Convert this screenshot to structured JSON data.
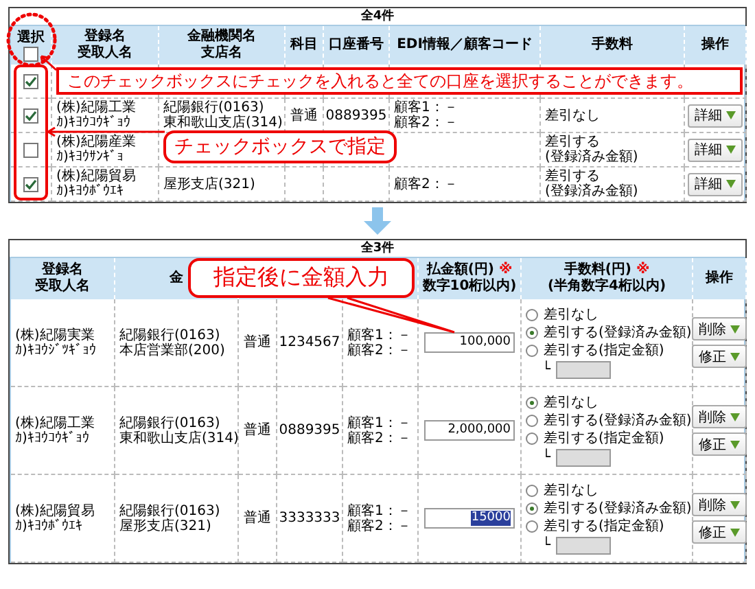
{
  "top": {
    "caption": "全4件",
    "headers": [
      [
        "選択"
      ],
      [
        "登録名",
        "受取人名"
      ],
      [
        "金融機関名",
        "支店名"
      ],
      [
        "科目"
      ],
      [
        "口座番号"
      ],
      [
        "EDI情報／顧客コード"
      ],
      [
        "手数料"
      ],
      [
        "操作"
      ]
    ],
    "select_all": {
      "checked": false
    },
    "rows": [
      {
        "checked": true
      },
      {
        "checked": true,
        "name": [
          "(株)紀陽工業",
          "ｶ)ｷﾖｳｺｳｷﾞｮｳ"
        ],
        "bank": [
          "紀陽銀行(0163)",
          "東和歌山支店(314)"
        ],
        "type": "普通",
        "account": "0889395",
        "edi": [
          "顧客1：－",
          "顧客2：－"
        ],
        "fee": [
          "差引なし"
        ],
        "action": "詳細"
      },
      {
        "checked": false,
        "name": [
          "(株)紀陽産業",
          "ｶ)ｷﾖｳｻﾝｷﾞｮ"
        ],
        "fee": [
          "差引する",
          "(登録済み金額)"
        ],
        "action": "詳細"
      },
      {
        "checked": true,
        "name": [
          "(株)紀陽貿易",
          "ｶ)ｷﾖｳﾎﾞｳｴｷ"
        ],
        "bank": [
          "屋形支店(321)"
        ],
        "edi": [
          "顧客2：－"
        ],
        "fee": [
          "差引する",
          "(登録済み金額)"
        ],
        "action": "詳細"
      }
    ],
    "banner": "このチェックボックスにチェックを入れると全ての口座を選択することができます。",
    "callout": "チェックボックスで指定"
  },
  "bottom": {
    "caption": "全3件",
    "headers": [
      {
        "lines": [
          "登録名",
          "受取人名"
        ]
      },
      {
        "lines": [
          "金"
        ]
      },
      {
        "lines": [
          "払金額(円)",
          "数字10桁以内)"
        ],
        "note": "※"
      },
      {
        "lines": [
          "手数料(円)",
          "(半角数字4桁以内)"
        ],
        "note": "※"
      },
      {
        "lines": [
          "操作"
        ]
      }
    ],
    "rows": [
      {
        "name": [
          "(株)紀陽実業",
          "ｶ)ｷﾖｳｼﾞﾂｷﾞｮｳ"
        ],
        "bank": [
          "紀陽銀行(0163)",
          "本店営業部(200)"
        ],
        "type": "普通",
        "account": "1234567",
        "edi": [
          "顧客1：－",
          "顧客2：－"
        ],
        "amount": "100,000",
        "amount_selected": false,
        "fee_options": [
          {
            "label": "差引なし",
            "selected": false
          },
          {
            "label": "差引する(登録済み金額)",
            "selected": true
          },
          {
            "label": "差引する(指定金額)",
            "selected": false
          }
        ],
        "custom_prefix": "└",
        "buttons": [
          "削除",
          "修正"
        ]
      },
      {
        "name": [
          "(株)紀陽工業",
          "ｶ)ｷﾖｳｺｳｷﾞｮｳ"
        ],
        "bank": [
          "紀陽銀行(0163)",
          "東和歌山支店(314)"
        ],
        "type": "普通",
        "account": "0889395",
        "edi": [
          "顧客1：－",
          "顧客2：－"
        ],
        "amount": "2,000,000",
        "amount_selected": false,
        "fee_options": [
          {
            "label": "差引なし",
            "selected": true
          },
          {
            "label": "差引する(登録済み金額)",
            "selected": false
          },
          {
            "label": "差引する(指定金額)",
            "selected": false
          }
        ],
        "custom_prefix": "└",
        "buttons": [
          "削除",
          "修正"
        ]
      },
      {
        "name": [
          "(株)紀陽貿易",
          "ｶ)ｷﾖｳﾎﾞｳｴｷ"
        ],
        "bank": [
          "紀陽銀行(0163)",
          "屋形支店(321)"
        ],
        "type": "普通",
        "account": "3333333",
        "edi": [
          "顧客1：－",
          "顧客2：－"
        ],
        "amount": "15000",
        "amount_selected": true,
        "fee_options": [
          {
            "label": "差引なし",
            "selected": false
          },
          {
            "label": "差引する(登録済み金額)",
            "selected": true
          },
          {
            "label": "差引する(指定金額)",
            "selected": false
          }
        ],
        "custom_prefix": "└",
        "buttons": [
          "削除",
          "修正"
        ]
      }
    ],
    "callout": "指定後に金額入力"
  }
}
